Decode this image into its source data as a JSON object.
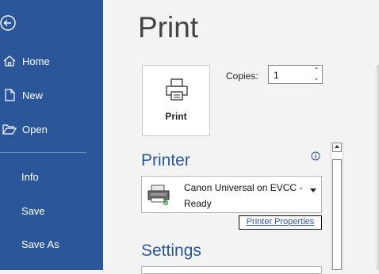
{
  "sidebar": {
    "items": [
      {
        "label": "Home",
        "icon": "home-icon"
      },
      {
        "label": "New",
        "icon": "new-document-icon"
      },
      {
        "label": "Open",
        "icon": "folder-open-icon"
      },
      {
        "label": "Info"
      },
      {
        "label": "Save"
      },
      {
        "label": "Save As"
      }
    ],
    "back_icon": "back-arrow-icon"
  },
  "main": {
    "title": "Print",
    "print_button_label": "Print",
    "copies_label": "Copies:",
    "copies_value": "1",
    "printer_heading": "Printer",
    "printer_name": "Canon Universal on  EVCC -",
    "printer_status": "Ready",
    "printer_properties_link": "Printer Properties",
    "settings_heading": "Settings"
  },
  "colors": {
    "sidebar_bg": "#2b579a",
    "accent": "#2b579a",
    "page_bg": "#f3f3f3"
  }
}
